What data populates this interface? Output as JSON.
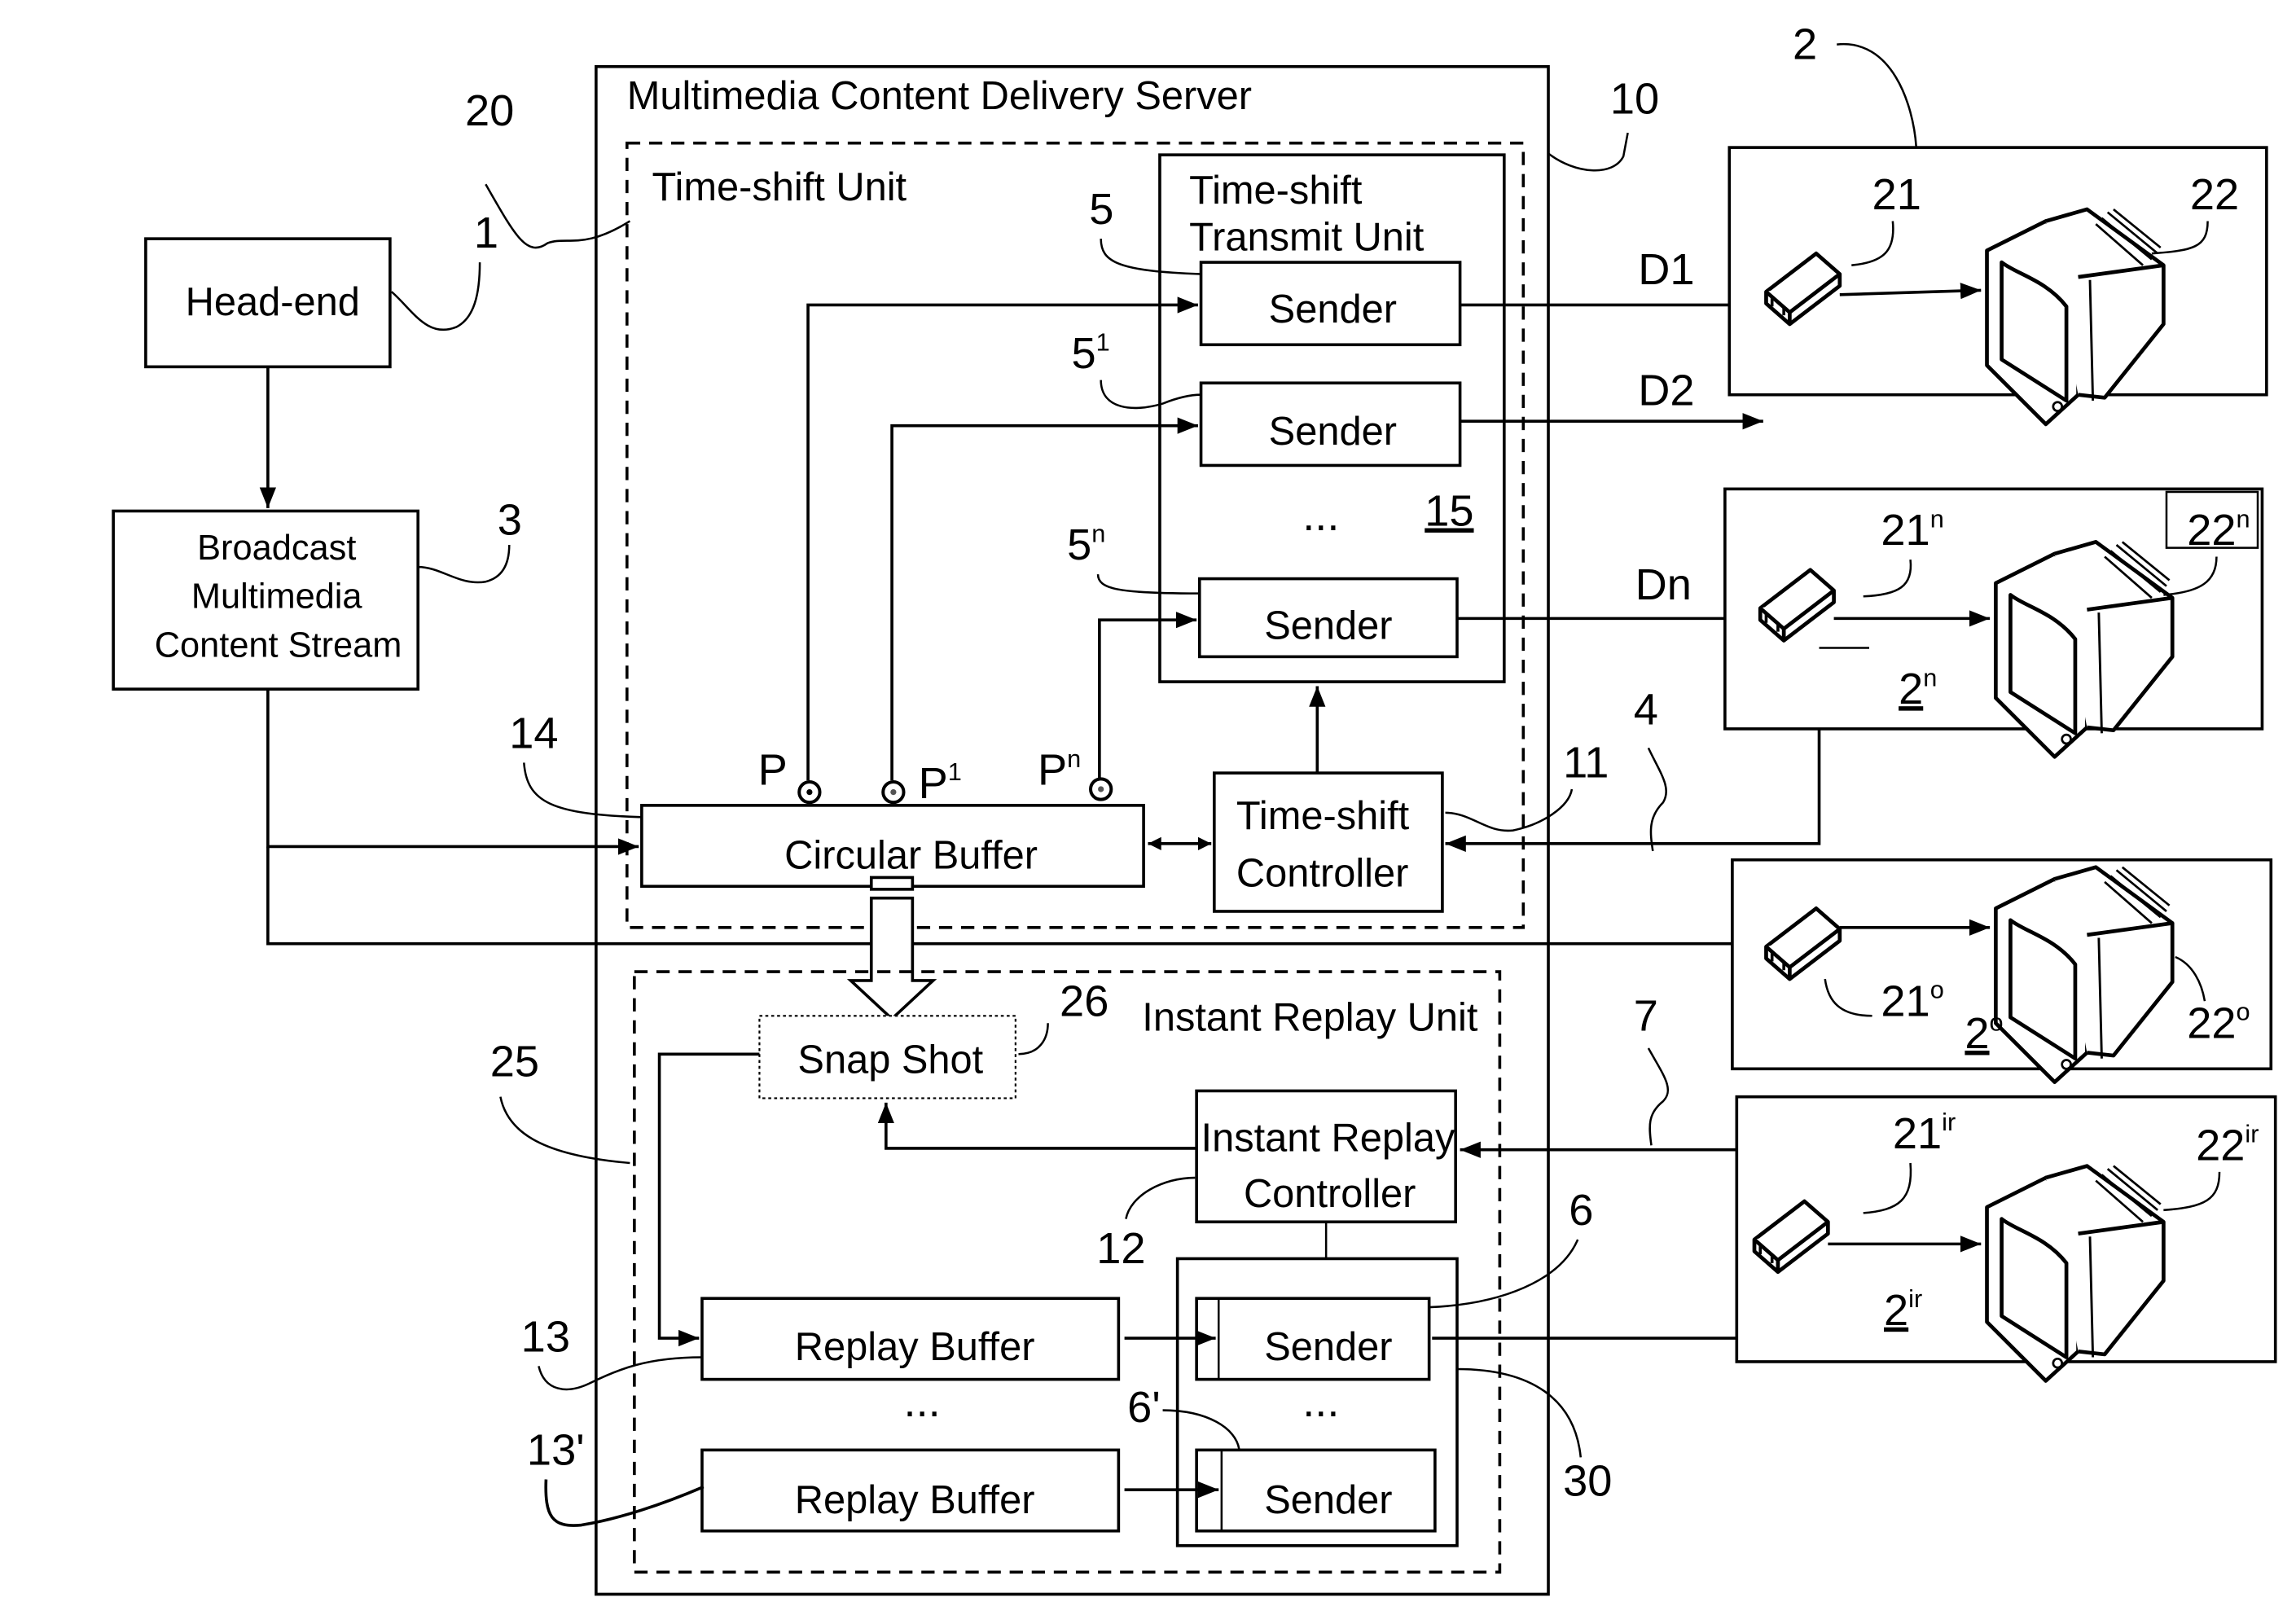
{
  "figure": {
    "server": {
      "title": "Multimedia Content Delivery Server",
      "ref": "10"
    },
    "time_shift_unit": {
      "title": "Time-shift Unit",
      "ref": "20",
      "transmit_unit": {
        "title_line1": "Time-shift",
        "title_line2": "Transmit Unit",
        "ref": "15"
      },
      "senders": [
        {
          "label": "Sender",
          "ref": "5",
          "ref_sup": "",
          "output": "D1"
        },
        {
          "label": "Sender",
          "ref": "5",
          "ref_sup": "1",
          "output": "D2"
        },
        {
          "label": "Sender",
          "ref": "5",
          "ref_sup": "n",
          "output": "Dn"
        }
      ],
      "ellipsis": "...",
      "circular_buffer": {
        "label": "Circular Buffer",
        "ref": "14"
      },
      "pointers": [
        {
          "label": "P",
          "sup": ""
        },
        {
          "label": "P",
          "sup": "1"
        },
        {
          "label": "P",
          "sup": "n"
        }
      ],
      "controller": {
        "line1": "Time-shift",
        "line2": "Controller",
        "ref": "11"
      }
    },
    "instant_replay_unit": {
      "title": "Instant Replay Unit",
      "ref": "25",
      "snapshot": {
        "label": "Snap Shot",
        "ref": "26"
      },
      "controller": {
        "line1": "Instant Replay",
        "line2": "Controller",
        "ref": "12"
      },
      "replay_buffers": [
        {
          "label": "Replay Buffer",
          "ref": "13"
        },
        {
          "label": "Replay Buffer",
          "ref": "13'"
        }
      ],
      "senders": [
        {
          "label": "Sender",
          "ref": "6"
        },
        {
          "label": "Sender",
          "ref": "6'"
        }
      ],
      "sender_group_ref": "30",
      "ellipsis": "..."
    },
    "head_end": {
      "label": "Head-end",
      "ref": "1"
    },
    "stream": {
      "line1": "Broadcast",
      "line2": "Multimedia",
      "line3": "Content Stream",
      "ref": "3"
    },
    "links": {
      "time_shift_request": "4",
      "replay_request": "7"
    },
    "clients": [
      {
        "ref": "2",
        "ref_sup": "",
        "ref_underlined": false,
        "stb": "21",
        "stb_sup": "",
        "tv": "22",
        "tv_sup": ""
      },
      {
        "ref": "2",
        "ref_sup": "n",
        "ref_underlined": true,
        "stb": "21",
        "stb_sup": "n",
        "tv": "22",
        "tv_sup": "n"
      },
      {
        "ref": "2",
        "ref_sup": "o",
        "ref_underlined": true,
        "stb": "21",
        "stb_sup": "o",
        "tv": "22",
        "tv_sup": "o"
      },
      {
        "ref": "2",
        "ref_sup": "ir",
        "ref_underlined": true,
        "stb": "21",
        "stb_sup": "ir",
        "tv": "22",
        "tv_sup": "ir"
      }
    ]
  }
}
